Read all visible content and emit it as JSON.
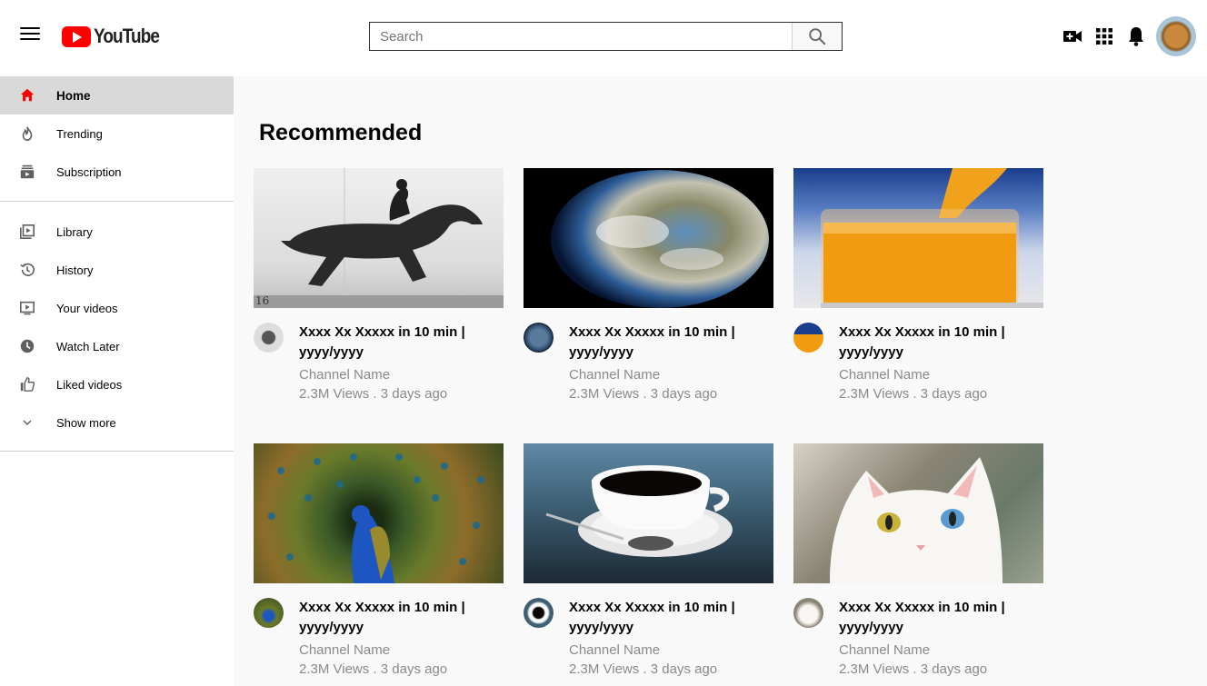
{
  "header": {
    "logo_text": "YouTube",
    "search_placeholder": "Search"
  },
  "sidebar": {
    "primary": [
      {
        "label": "Home",
        "icon": "home-icon",
        "active": true
      },
      {
        "label": "Trending",
        "icon": "fire-icon"
      },
      {
        "label": "Subscription",
        "icon": "subscriptions-icon"
      }
    ],
    "secondary": [
      {
        "label": "Library",
        "icon": "library-icon"
      },
      {
        "label": "History",
        "icon": "history-icon"
      },
      {
        "label": "Your videos",
        "icon": "your-videos-icon"
      },
      {
        "label": "Watch Later",
        "icon": "clock-icon"
      },
      {
        "label": "Liked videos",
        "icon": "thumbs-up-icon"
      },
      {
        "label": "Show more",
        "icon": "chevron-down-icon"
      }
    ]
  },
  "main": {
    "title": "Recommended",
    "videos": [
      {
        "title": "Xxxx Xx Xxxxx in 10 min | yyyy/yyyy",
        "channel": "Channel Name",
        "stats": "2.3M Views . 3 days ago",
        "thumb": "horse"
      },
      {
        "title": "Xxxx Xx Xxxxx in 10 min | yyyy/yyyy",
        "channel": "Channel Name",
        "stats": "2.3M Views . 3 days ago",
        "thumb": "earth"
      },
      {
        "title": "Xxxx Xx Xxxxx in 10 min | yyyy/yyyy",
        "channel": "Channel Name",
        "stats": "2.3M Views . 3 days ago",
        "thumb": "orange-juice"
      },
      {
        "title": "Xxxx Xx Xxxxx in 10 min | yyyy/yyyy",
        "channel": "Channel Name",
        "stats": "2.3M Views . 3 days ago",
        "thumb": "peacock"
      },
      {
        "title": "Xxxx Xx Xxxxx in 10 min | yyyy/yyyy",
        "channel": "Channel Name",
        "stats": "2.3M Views . 3 days ago",
        "thumb": "coffee"
      },
      {
        "title": "Xxxx Xx Xxxxx in 10 min | yyyy/yyyy",
        "channel": "Channel Name",
        "stats": "2.3M Views . 3 days ago",
        "thumb": "white-cat"
      }
    ]
  },
  "colors": {
    "brand_red": "#ff0000",
    "active_bg": "#d9d9d9",
    "page_bg": "#f9f9f9",
    "meta_text": "#8a8a8a"
  }
}
